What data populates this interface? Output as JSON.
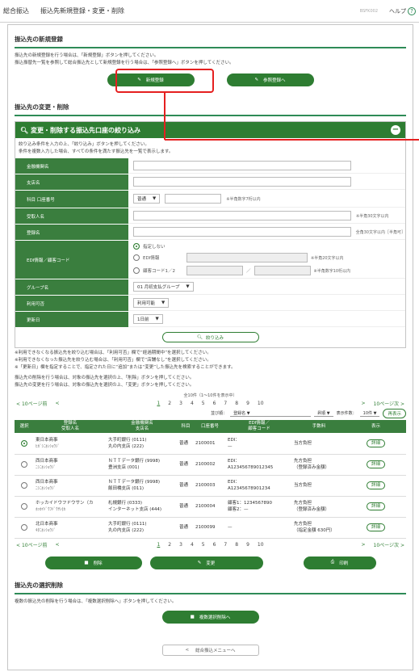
{
  "header": {
    "title": "総合振込",
    "subtitle": "振込先新規登録・変更・削除",
    "screen_id": "BSFK002",
    "help": "ヘルプ"
  },
  "new": {
    "title": "振込先の新規登録",
    "note1": "振込先の新規登録を行う場合は、「新規登録」ボタンを押してください。",
    "note2": "振込振替先一覧を参照して総合振込先として新規登録を行う場合は、「参照登録へ」ボタンを押してください。",
    "btn_new": "新規登録",
    "btn_ref": "参照登録へ"
  },
  "change": {
    "title": "振込先の変更・削除"
  },
  "filter": {
    "title": "変更・削除する振込先口座の絞り込み",
    "note1": "絞り込み条件を入力の上、「絞り込み」ボタンを押してください。",
    "note2": "条件を複数入力した場合、すべての条件を満たす振込先を一覧で表示します。",
    "labels": [
      "金融機関名",
      "支店名",
      "科目 口座番号",
      "受取人名",
      "登録名",
      "EDI情報／顧客コード",
      "グループ名",
      "利用可否",
      "更新日"
    ],
    "acct_type": "普通",
    "acct_hint": "※半角数字7桁以内",
    "payee_hint": "※半角30文字以内",
    "reg_hint": "全角30文字以内［半角可］",
    "edi_opt1": "指定しない",
    "edi_opt2": "EDI情報",
    "edi_opt3": "顧客コード1／2",
    "edi_hint1": "※半角20文字以内",
    "edi_hint2": "※半角数字10桁以内",
    "group": "01 月初支払グループ",
    "avail": "利用可能",
    "updated": "1日前",
    "btn": "絞り込み"
  },
  "warn": {
    "l1": "※利用できなくなる振込先を絞り込む場合は、「利用可否」欄で“経過期間中”を選択してください。",
    "l2": "※利用できなくなった振込先を絞り込む場合は、「利用可否」欄で“店舗なし”を選択してください。",
    "l3": "※「更新日」欄を指定することで、指定された日に“追加”または“変更”した振込先を検索することができます。",
    "l4": "振込先の削除を行う場合は、対象の振込先を選択の上、「削除」ボタンを押してください。",
    "l5": "振込先の変更を行う場合は、対象の振込先を選択の上、「変更」ボタンを押してください。"
  },
  "list": {
    "count": "全10件（1〜10件を表示中）",
    "prev10": "10ページ前",
    "next10": "10ページ次",
    "pages": [
      "1",
      "2",
      "3",
      "4",
      "5",
      "6",
      "7",
      "8",
      "9",
      "10"
    ],
    "sort_label": "並び順：",
    "sort_val": "登録名",
    "order": "昇順",
    "per_label": "表示件数：",
    "per_val": "10件",
    "redisp": "再表示",
    "headers": [
      "選択",
      "登録名\n受取人名",
      "金融機関名\n支店名",
      "科目",
      "口座番号",
      "EDI情報／\n顧客コード",
      "手数料",
      "表示"
    ],
    "rows": [
      {
        "n1": "東日本商事",
        "n2": "ﾋｶﾞｼﾆﾎﾝｼｮｳｼﾞ",
        "b1": "大手町銀行 (0111)",
        "b2": "丸の内支店 (222)",
        "t": "普通",
        "a": "2100001",
        "e1": "EDI：",
        "e2": "—",
        "f1": "当方負担",
        "f2": "",
        "d": "詳細"
      },
      {
        "n1": "西日本商事",
        "n2": "ﾆｼﾆﾎﾝｼｮｳｼﾞ",
        "b1": "ＮＴＴデータ銀行 (9998)",
        "b2": "豊洲支店 (001)",
        "t": "普通",
        "a": "2100002",
        "e1": "EDI：",
        "e2": "A123456789012345",
        "f1": "先方負担",
        "f2": "（登録済み金額）",
        "d": "詳細"
      },
      {
        "n1": "西日本商事",
        "n2": "ﾆｼﾆﾎﾝｼｮｳｼﾞ",
        "b1": "ＮＴＴデータ銀行 (9998)",
        "b2": "飯田橋支店 (011)",
        "t": "普通",
        "a": "2100003",
        "e1": "EDI：",
        "e2": "A12345678901234",
        "f1": "当方負担",
        "f2": "",
        "d": "詳細"
      },
      {
        "n1": "ホッカイドウフドウサン（カ",
        "n2": "ﾎｯｶｲﾄﾞｳﾌﾄﾞｳｻﾝ(ｶ",
        "b1": "札幌銀行 (0333)",
        "b2": "インターネット支店 (444)",
        "t": "普通",
        "a": "2100004",
        "e1": "顧客1：1234567890",
        "e2": "顧客2：—",
        "f1": "先方負担",
        "f2": "（登録済み金額）",
        "d": "詳細"
      },
      {
        "n1": "北日本商事",
        "n2": "ｷﾀﾆﾎﾝｼｮｳｼﾞ",
        "b1": "大手町銀行 (0111)",
        "b2": "丸の内支店 (222)",
        "t": "普通",
        "a": "2100099",
        "e1": "—",
        "e2": "",
        "f1": "先方負担",
        "f2": "（指定金額 630円）",
        "d": "詳細"
      }
    ],
    "btn_del": "削除",
    "btn_chg": "変更",
    "btn_print": "印刷"
  },
  "bulk": {
    "title": "振込先の選択削除",
    "note": "複数の振込先の削除を行う場合は、「複数選択削除へ」ボタンを押してください。",
    "btn": "複数選択削除へ"
  },
  "footer": {
    "back": "総合振込メニューへ"
  },
  "colors": {
    "accent": "#2e7d32",
    "callout": "#e52020"
  }
}
